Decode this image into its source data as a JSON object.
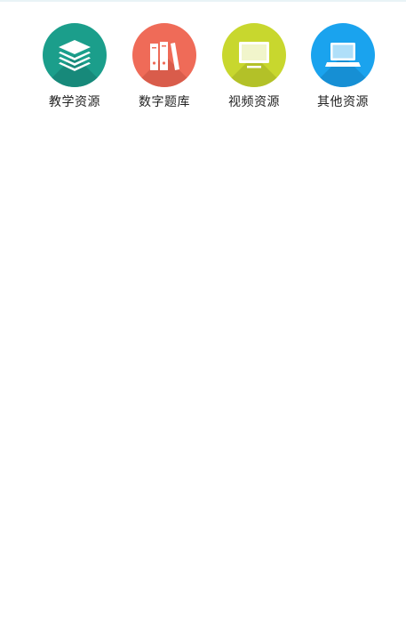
{
  "tiles": [
    {
      "label": "教学资源",
      "icon": "layers-icon",
      "color": "#1b9e8b",
      "shade": "#17897a"
    },
    {
      "label": "数字题库",
      "icon": "books-icon",
      "color": "#ef6b58",
      "shade": "#d95c4b"
    },
    {
      "label": "视频资源",
      "icon": "monitor-icon",
      "color": "#c8d72e",
      "shade": "#b3c128"
    },
    {
      "label": "其他资源",
      "icon": "laptop-icon",
      "color": "#1aa3ee",
      "shade": "#168fd4"
    }
  ]
}
